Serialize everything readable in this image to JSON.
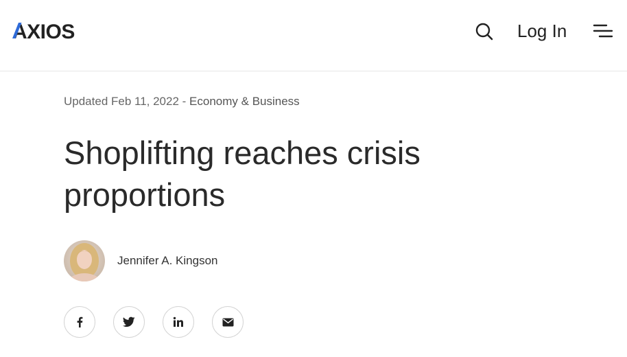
{
  "header": {
    "logo_text": "AXIOS",
    "search_icon": "search-icon",
    "login_label": "Log In",
    "menu_icon": "menu-icon"
  },
  "article": {
    "updated": "Updated Feb 11, 2022",
    "separator": " - ",
    "category": "Economy & Business",
    "title": "Shoplifting reaches crisis proportions",
    "author": "Jennifer A. Kingson",
    "avatar_icon": "author-avatar"
  },
  "share": [
    {
      "icon": "facebook-icon"
    },
    {
      "icon": "twitter-icon"
    },
    {
      "icon": "linkedin-icon"
    },
    {
      "icon": "email-icon"
    }
  ],
  "colors": {
    "logo_blue": "#2f6bd8",
    "logo_dark": "#222222",
    "text": "#2a2a2a",
    "meta": "#666666",
    "border": "#d4d4d4"
  }
}
